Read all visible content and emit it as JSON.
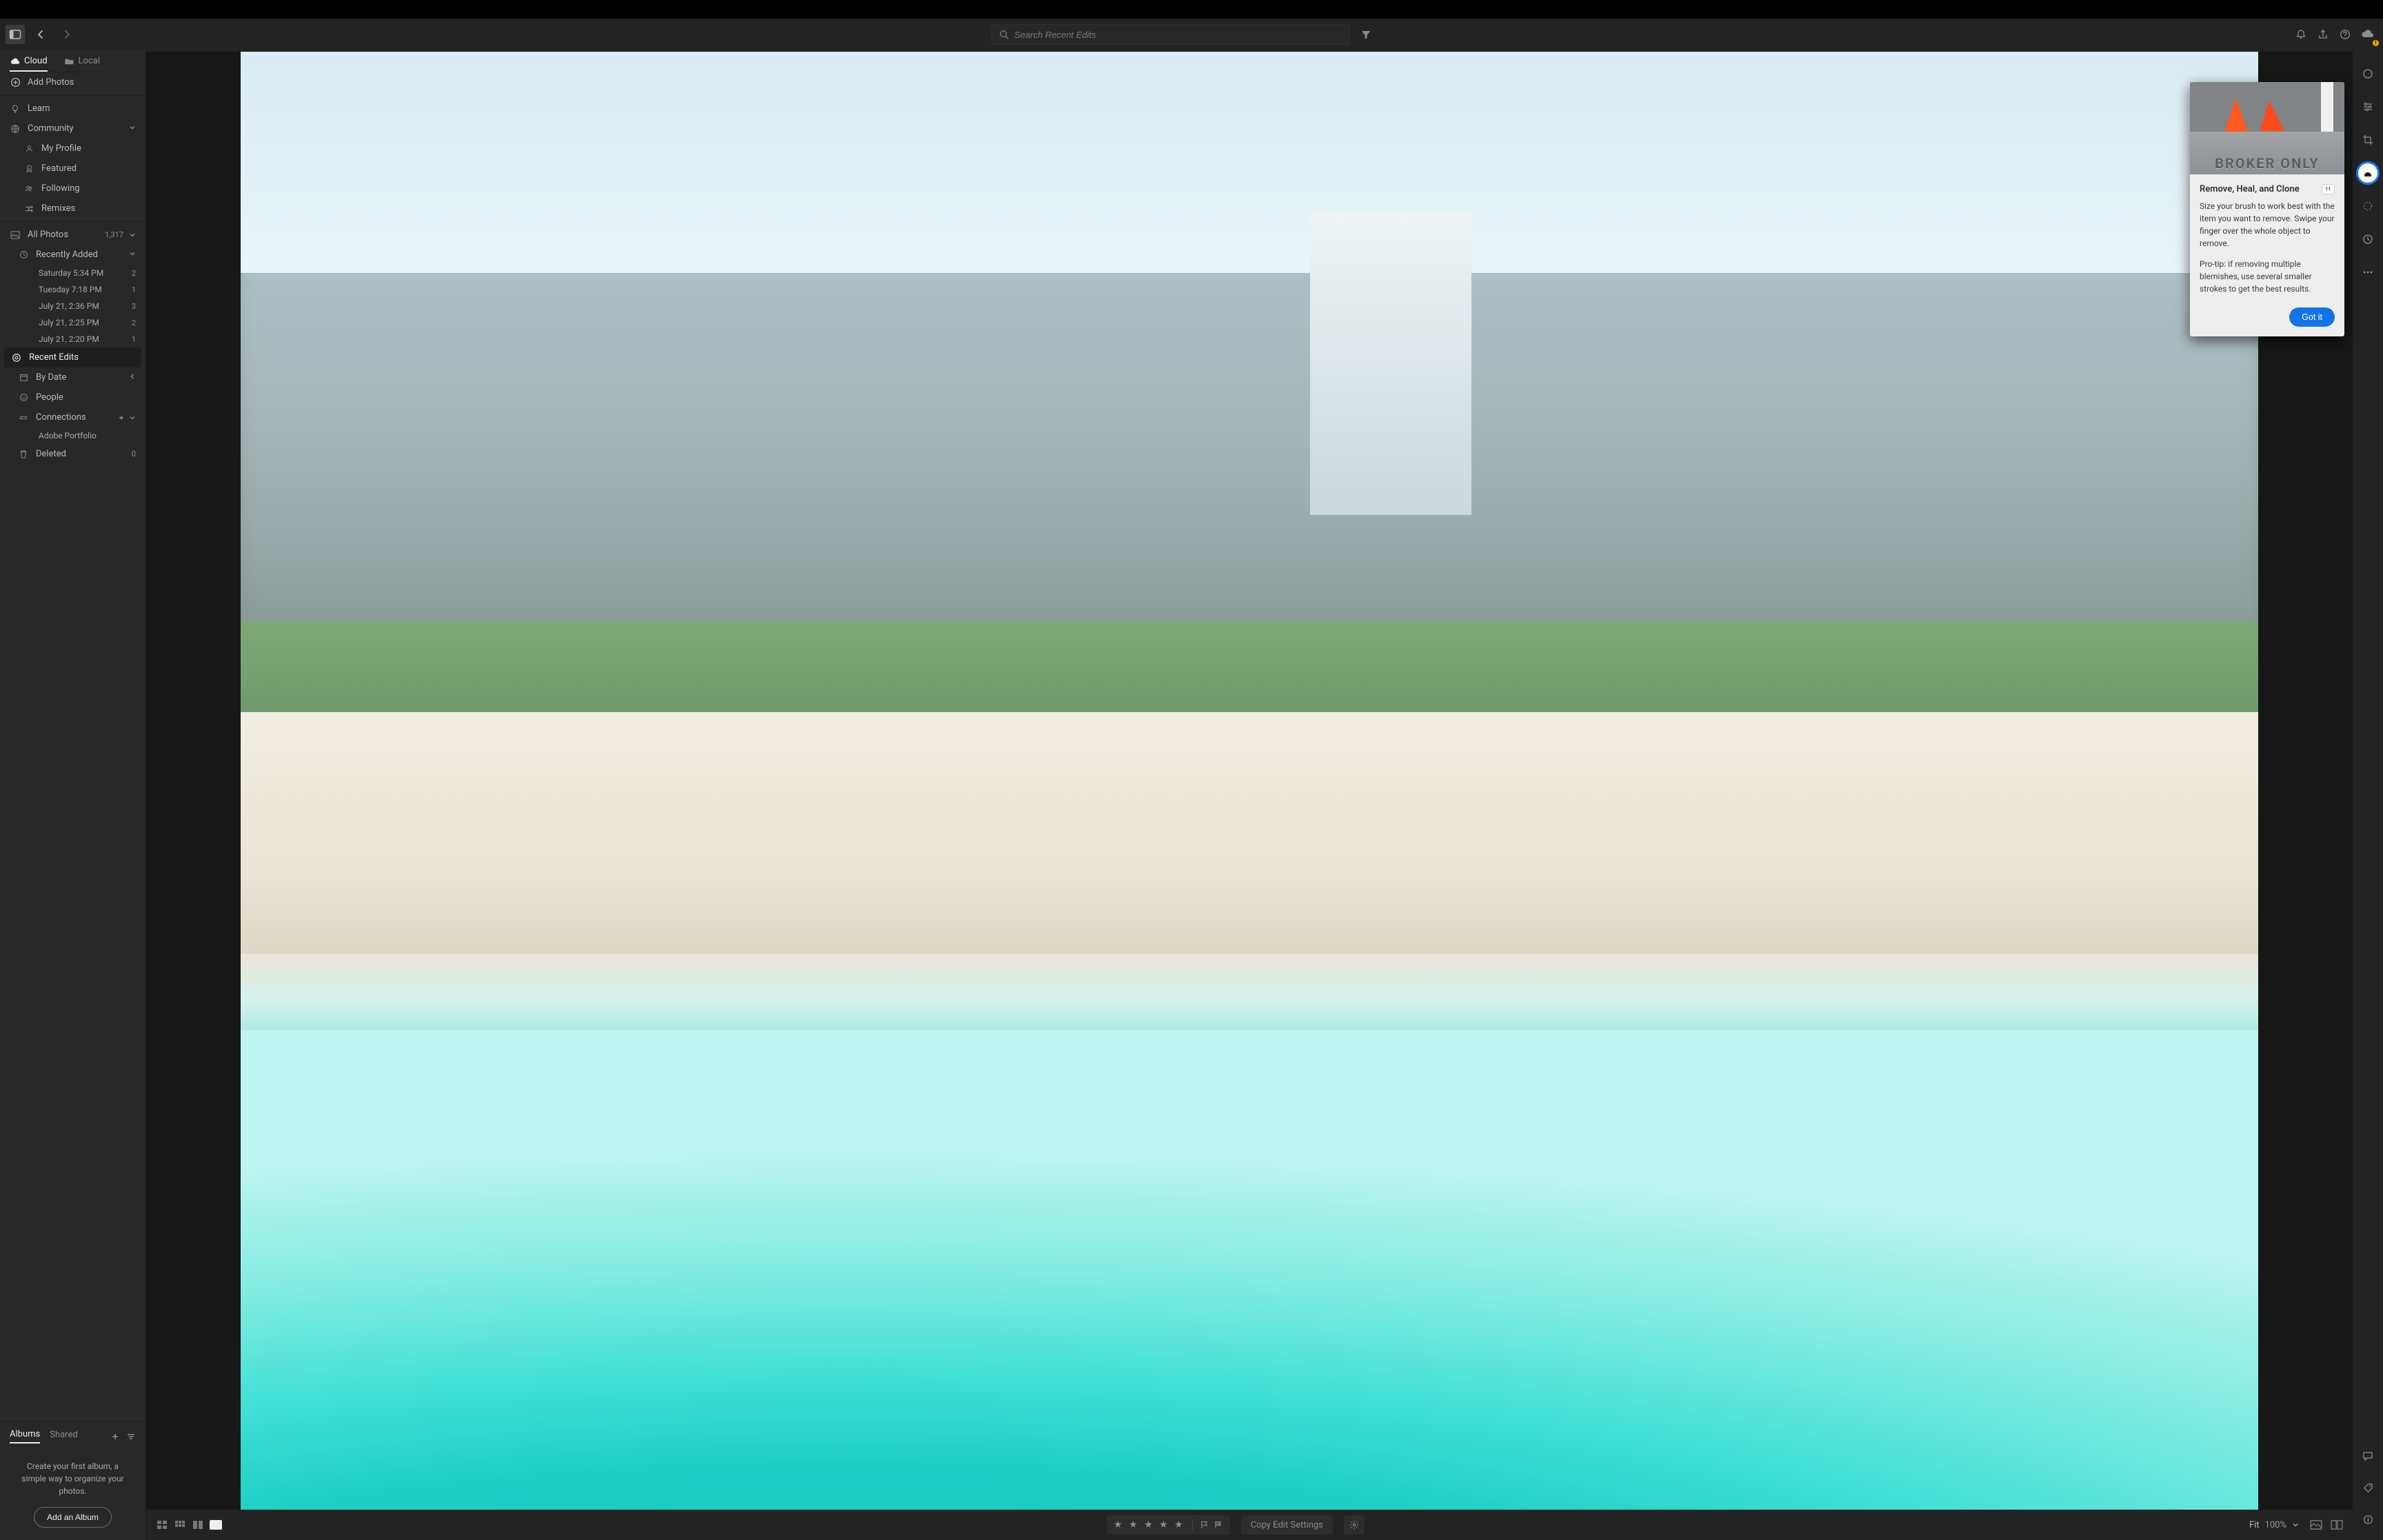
{
  "topbar": {
    "search_placeholder": "Search Recent Edits"
  },
  "sidebar": {
    "tabs": {
      "cloud": "Cloud",
      "local": "Local"
    },
    "add_photos": "Add Photos",
    "learn": "Learn",
    "community": "Community",
    "community_items": {
      "my_profile": "My Profile",
      "featured": "Featured",
      "following": "Following",
      "remixes": "Remixes"
    },
    "all_photos": {
      "label": "All Photos",
      "count": "1,317"
    },
    "recently_added_label": "Recently Added",
    "recent_items": [
      {
        "label": "Saturday  5:34 PM",
        "count": "2"
      },
      {
        "label": "Tuesday  7:18 PM",
        "count": "1"
      },
      {
        "label": "July 21, 2:36 PM",
        "count": "3"
      },
      {
        "label": "July 21, 2:25 PM",
        "count": "2"
      },
      {
        "label": "July 21, 2:20 PM",
        "count": "1"
      }
    ],
    "recent_edits": "Recent Edits",
    "by_date": "By Date",
    "people": "People",
    "connections": "Connections",
    "connections_items": {
      "portfolio": "Adobe Portfolio"
    },
    "deleted": {
      "label": "Deleted",
      "count": "0"
    }
  },
  "albums": {
    "tab_albums": "Albums",
    "tab_shared": "Shared",
    "empty_text": "Create your first album, a simple way to organize your photos.",
    "add_button": "Add an Album"
  },
  "bottombar": {
    "copy_edit": "Copy Edit Settings",
    "fit": "Fit",
    "zoom_pct": "100%"
  },
  "popover": {
    "hero_text": "BROKER ONLY",
    "title": "Remove, Heal, and Clone",
    "shortcut": "H",
    "p1": "Size your brush to work best with the item you want to remove. Swipe your finger over the whole object to remove.",
    "p2": "Pro-tip: if removing multiple blemishes, use several smaller strokes to get the best results.",
    "cta": "Got it"
  }
}
